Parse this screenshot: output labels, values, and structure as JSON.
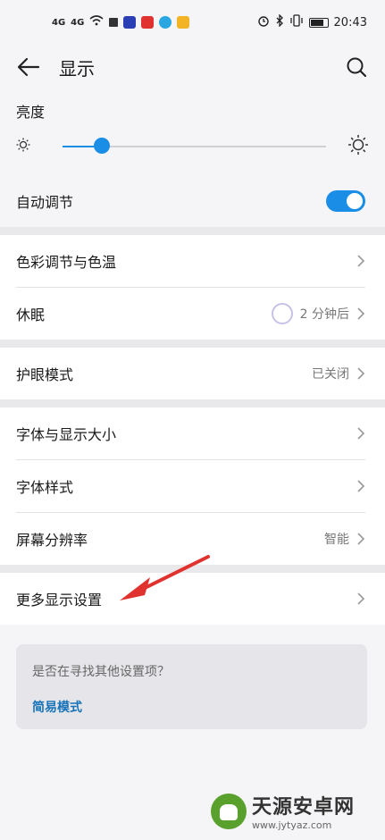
{
  "status_bar": {
    "signal_left": "4G",
    "signal_right": "4G",
    "time": "20:43"
  },
  "header": {
    "title": "显示"
  },
  "brightness": {
    "label": "亮度",
    "level_percent": 15
  },
  "auto_adjust": {
    "label": "自动调节",
    "enabled": true
  },
  "groups": [
    {
      "items": [
        {
          "label": "色彩调节与色温",
          "value": ""
        },
        {
          "label": "休眠",
          "value": "2 分钟后"
        }
      ]
    },
    {
      "items": [
        {
          "label": "护眼模式",
          "value": "已关闭"
        }
      ]
    },
    {
      "items": [
        {
          "label": "字体与显示大小",
          "value": ""
        },
        {
          "label": "字体样式",
          "value": ""
        },
        {
          "label": "屏幕分辨率",
          "value": "智能"
        }
      ]
    },
    {
      "items": [
        {
          "label": "更多显示设置",
          "value": ""
        }
      ]
    }
  ],
  "help_card": {
    "question": "是否在寻找其他设置项？",
    "link": "简易模式"
  },
  "watermark": {
    "name": "天源安卓网",
    "url": "www.jytyaz.com"
  },
  "colors": {
    "accent": "#1a8ee6",
    "link": "#1773b8",
    "annotation_arrow": "#e0322f"
  }
}
